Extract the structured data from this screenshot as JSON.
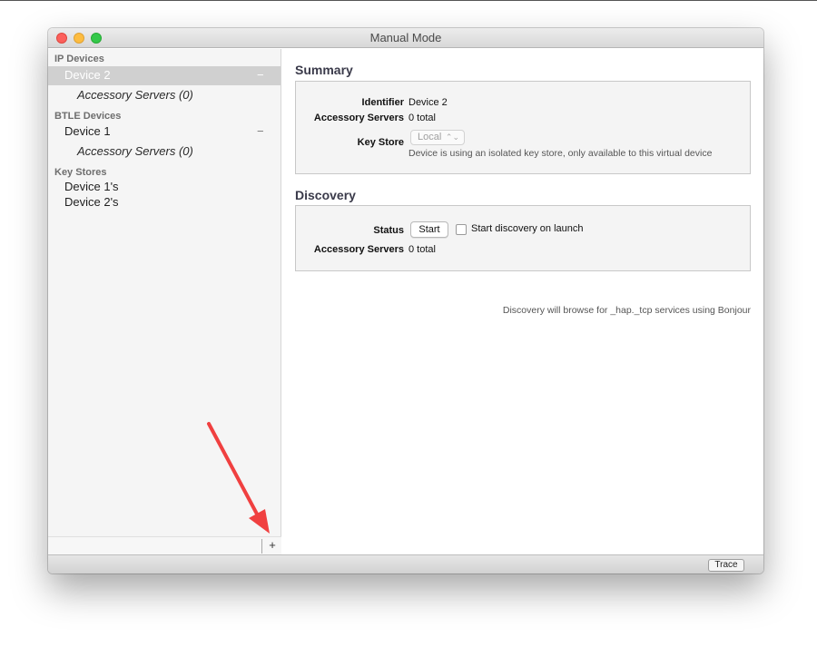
{
  "window": {
    "title": "Manual Mode"
  },
  "sidebar": {
    "groups": [
      {
        "header": "IP Devices",
        "items": [
          {
            "label": "Device 2",
            "selected": true,
            "sub": "Accessory Servers (0)",
            "remove": "−"
          }
        ]
      },
      {
        "header": "BTLE Devices",
        "items": [
          {
            "label": "Device 1",
            "selected": false,
            "sub": "Accessory Servers (0)",
            "remove": "−"
          }
        ]
      },
      {
        "header": "Key Stores",
        "items": [
          {
            "label": "Device 1's"
          },
          {
            "label": "Device 2's"
          }
        ]
      }
    ],
    "add_label": "+"
  },
  "summary": {
    "title": "Summary",
    "identifier_label": "Identifier",
    "identifier_value": "Device 2",
    "servers_label": "Accessory Servers",
    "servers_value": "0 total",
    "keystore_label": "Key Store",
    "keystore_value": "Local",
    "keystore_hint": "Device is using an isolated key store, only available to this virtual device"
  },
  "discovery": {
    "title": "Discovery",
    "status_label": "Status",
    "start_label": "Start",
    "checkbox_label": "Start discovery on launch",
    "checkbox_checked": false,
    "servers_label": "Accessory Servers",
    "servers_value": "0 total",
    "note": "Discovery will browse for _hap._tcp services using Bonjour"
  },
  "statusbar": {
    "trace_label": "Trace"
  },
  "colors": {
    "arrow": "#f04040",
    "selection": "#d0d0d0",
    "close": "#fc605c",
    "minimize": "#fdbc40",
    "zoom": "#34c84a"
  }
}
